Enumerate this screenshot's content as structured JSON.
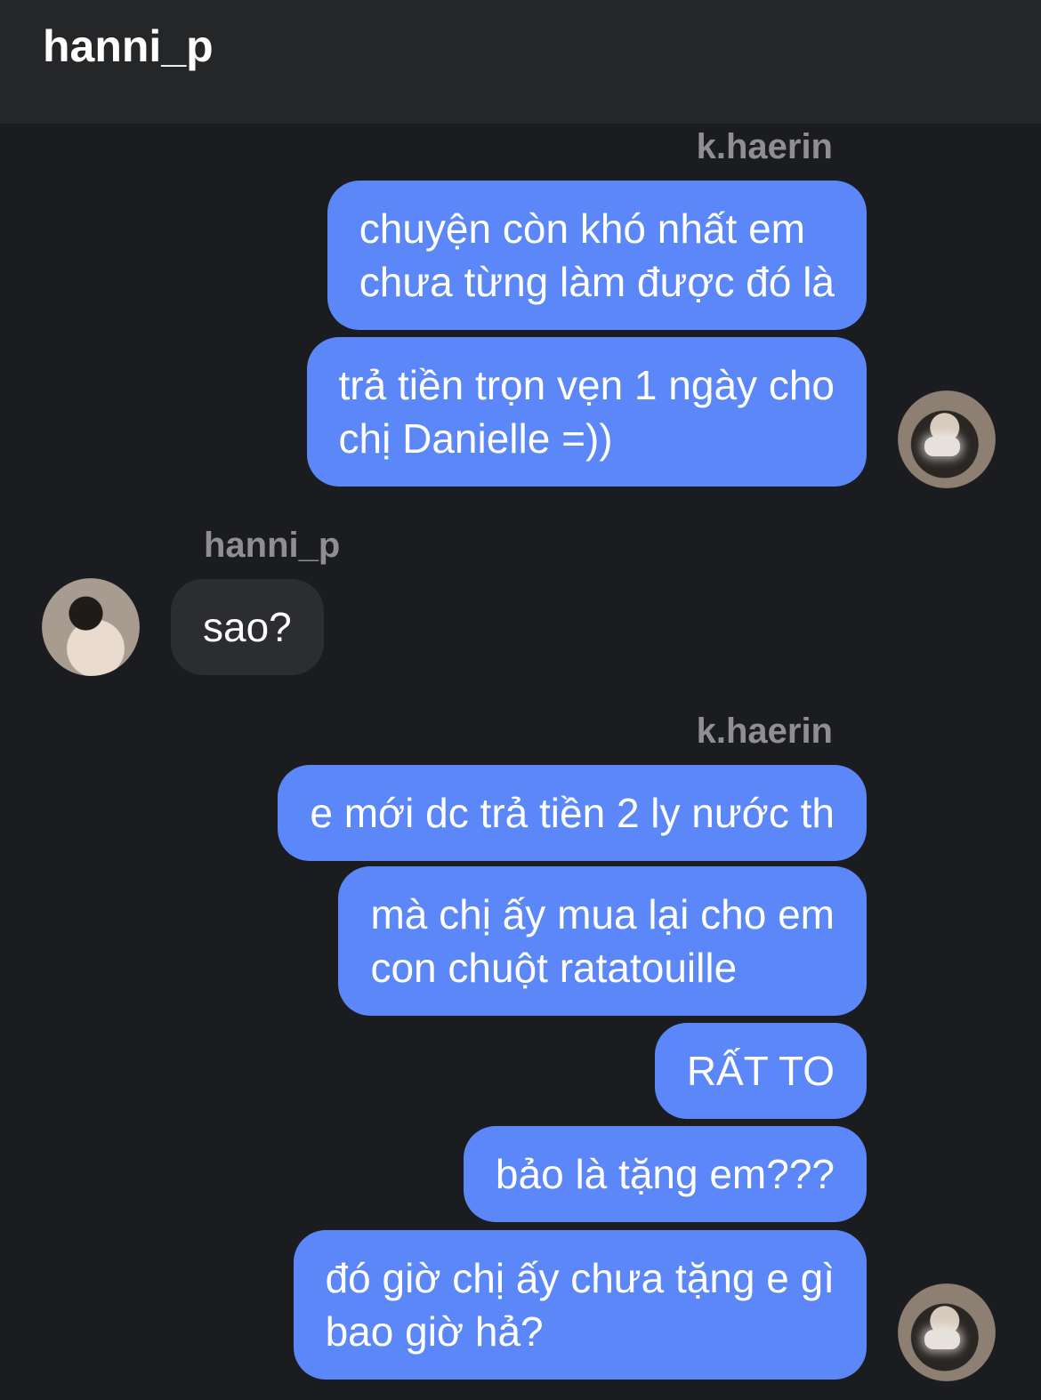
{
  "header": {
    "title": "hanni_p"
  },
  "messages": [
    {
      "sender": "k.haerin",
      "bubbles": [
        "chuyện còn khó nhất em\nchưa từng làm được đó là",
        "trả tiền trọn vẹn 1 ngày cho\nchị Danielle =))"
      ]
    },
    {
      "sender": "hanni_p",
      "bubbles": [
        "sao?"
      ]
    },
    {
      "sender": "k.haerin",
      "bubbles": [
        "e mới dc trả tiền 2 ly nước th",
        "mà chị ấy mua lại cho em\ncon chuột ratatouille",
        "RẤT TO",
        "bảo là tặng em???",
        "đó giờ chị ấy chưa tặng e gì\nbao giờ hả?"
      ]
    }
  ]
}
